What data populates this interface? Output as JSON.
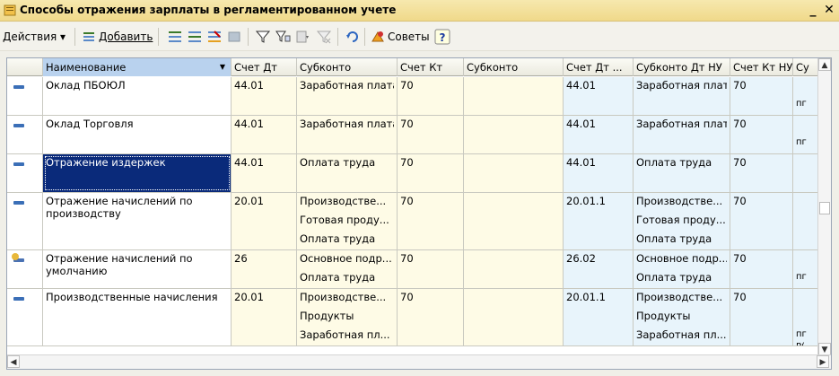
{
  "window": {
    "title": "Способы отражения зарплаты в регламентированном учете",
    "minimize_label": "_",
    "close_label": "✕"
  },
  "toolbar": {
    "actions_label": "Действия ▾",
    "add_label": "Добавить",
    "advice_label": "Советы"
  },
  "table": {
    "columns": [
      "Наименование",
      "Счет Дт",
      "Субконто",
      "Счет Кт",
      "Субконто",
      "Счет Дт ...",
      "Субконто Дт НУ",
      "Счет Кт НУ",
      "Су"
    ],
    "rows": [
      {
        "icon": "item-icon",
        "name": "Оклад ПБОЮЛ",
        "dt": "44.01",
        "sub1": [
          "Заработная плата"
        ],
        "kt": "70",
        "sub2": "",
        "dtnu": "44.01",
        "subdtnu": [
          "Заработная плата"
        ],
        "ktnu": "70",
        "sk": "пг"
      },
      {
        "icon": "item-icon",
        "name": "Оклад Торговля",
        "dt": "44.01",
        "sub1": [
          "Заработная плата"
        ],
        "kt": "70",
        "sub2": "",
        "dtnu": "44.01",
        "subdtnu": [
          "Заработная плата"
        ],
        "ktnu": "70",
        "sk": "пг"
      },
      {
        "icon": "item-icon",
        "name": "Отражение издержек",
        "dt": "44.01",
        "sub1": [
          "Оплата труда"
        ],
        "kt": "70",
        "sub2": "",
        "dtnu": "44.01",
        "subdtnu": [
          "Оплата труда"
        ],
        "ktnu": "70",
        "sk": ""
      },
      {
        "icon": "item-icon",
        "name": "Отражение начислений по производству",
        "dt": "20.01",
        "sub1": [
          "Производстве...",
          "Готовая проду...",
          "Оплата труда"
        ],
        "kt": "70",
        "sub2": "",
        "dtnu": "20.01.1",
        "subdtnu": [
          "Производстве...",
          "Готовая проду...",
          "Оплата труда"
        ],
        "ktnu": "70",
        "sk": ""
      },
      {
        "icon": "default-item-icon",
        "name": "Отражение начислений по умолчанию",
        "dt": "26",
        "sub1": [
          "Основное подр...",
          "Оплата труда"
        ],
        "kt": "70",
        "sub2": "",
        "dtnu": "26.02",
        "subdtnu": [
          "Основное подр...",
          "Оплата труда"
        ],
        "ktnu": "70",
        "sk": "пг"
      },
      {
        "icon": "item-icon",
        "name": "Производственные начисления",
        "dt": "20.01",
        "sub1": [
          "Производстве...",
          "Продукты",
          "Заработная пл..."
        ],
        "kt": "70",
        "sub2": "",
        "dtnu": "20.01.1",
        "subdtnu": [
          "Производстве...",
          "Продукты",
          "Заработная пл..."
        ],
        "ktnu": "70",
        "sk": "пг Р("
      }
    ]
  },
  "colors": {
    "selected_row": "#0a2a7a",
    "bu_columns": "#fefbe6",
    "nu_columns": "#e8f4fb"
  }
}
